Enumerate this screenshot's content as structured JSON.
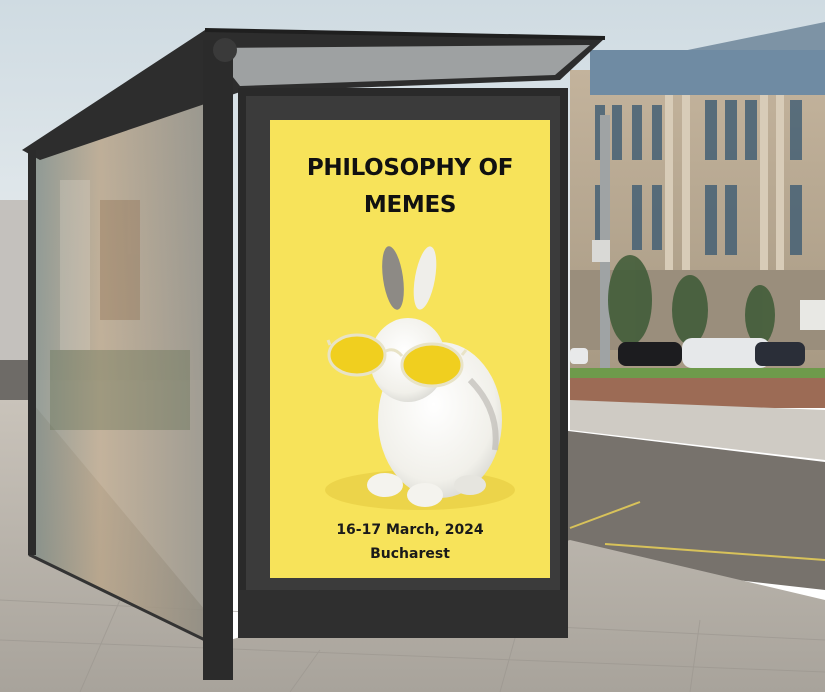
{
  "poster": {
    "title_line1": "PHILOSOPHY OF",
    "title_line2": "MEMES",
    "date": "16-17 March, 2024",
    "city": "Bucharest"
  },
  "scene": {
    "subject": "bus-stop-advertisement",
    "poster_background_color": "#f7e35a",
    "shelter_frame_color": "#2b2b2b",
    "sky_color": "#dfe6ea",
    "pavement_color": "#bdb8b1"
  }
}
